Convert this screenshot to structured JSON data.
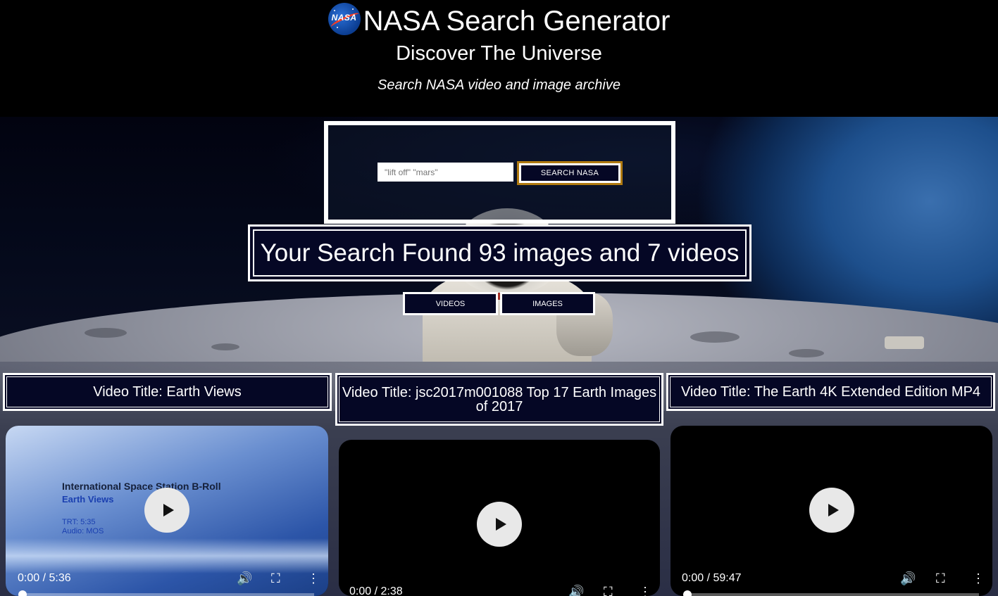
{
  "header": {
    "logo_text": "NASA",
    "title": "NASA Search Generator",
    "subtitle": "Discover The Universe",
    "tagline": "Search NASA video and image archive"
  },
  "search": {
    "placeholder": "\"lift off\" \"mars\"",
    "button_label": "SEARCH NASA"
  },
  "results_summary": "Your Search Found 93 images and 7 videos",
  "tabs": {
    "videos_label": "VIDEOS",
    "images_label": "IMAGES"
  },
  "videos": [
    {
      "title": "Video Title: Earth Views",
      "current_time": "0:00 / 5:36",
      "thumbnail": {
        "heading": "International Space Station B-Roll",
        "subheading": "Earth Views",
        "trt": "TRT: 5:35",
        "audio": "Audio: MOS"
      }
    },
    {
      "title": "Video Title: jsc2017m001088 Top 17 Earth Images of 2017",
      "current_time": "0:00 / 2:38"
    },
    {
      "title": "Video Title: The Earth 4K Extended Edition MP4",
      "current_time": "0:00 / 59:47"
    }
  ],
  "icons": {
    "play": "play-icon",
    "volume": "volume-icon",
    "fullscreen": "fullscreen-icon",
    "more": "more-vert-icon"
  },
  "colors": {
    "button_bg": "#050725",
    "button_border_accent": "#b07a10",
    "page_bg": "#000000"
  }
}
